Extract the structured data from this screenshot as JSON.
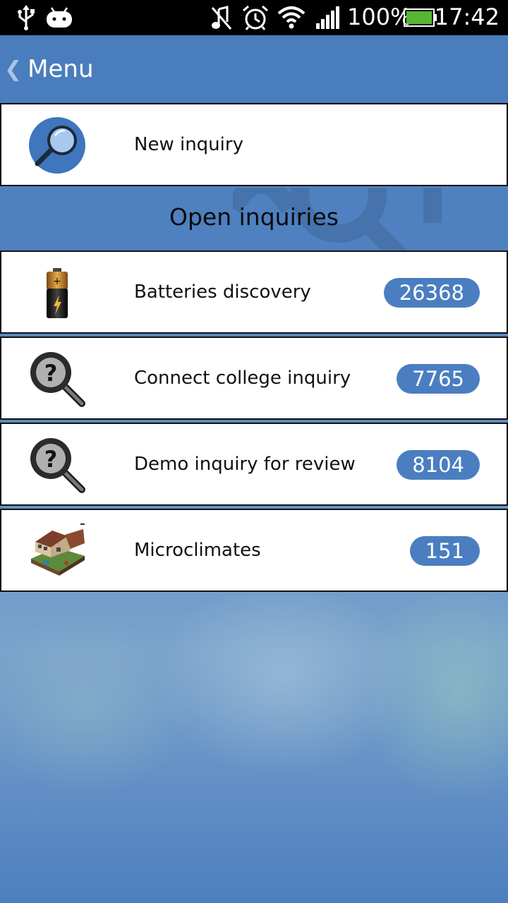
{
  "status_bar": {
    "battery_percent": "100%",
    "time": "17:42",
    "icons": [
      "usb-icon",
      "android-icon",
      "music-off-icon",
      "alarm-icon",
      "wifi-icon",
      "signal-icon",
      "battery-icon"
    ]
  },
  "header": {
    "back_chevron": "❮",
    "title": "Menu"
  },
  "new_inquiry": {
    "label": "New inquiry",
    "icon": "magnifier-icon"
  },
  "section": {
    "title": "Open inquiries"
  },
  "inquiries": [
    {
      "label": "Batteries discovery",
      "count": "26368",
      "icon": "battery-thumbnail"
    },
    {
      "label": "Connect college inquiry",
      "count": "7765",
      "icon": "question-magnifier-icon"
    },
    {
      "label": "Demo inquiry for review",
      "count": "8104",
      "icon": "question-magnifier-icon"
    },
    {
      "label": "Microclimates",
      "count": "151",
      "icon": "house-diagram-thumbnail"
    }
  ],
  "colors": {
    "header": "#4a7dbd",
    "badge": "#4a7ec0",
    "row_background": "#ffffff",
    "status_bar": "#000000"
  }
}
